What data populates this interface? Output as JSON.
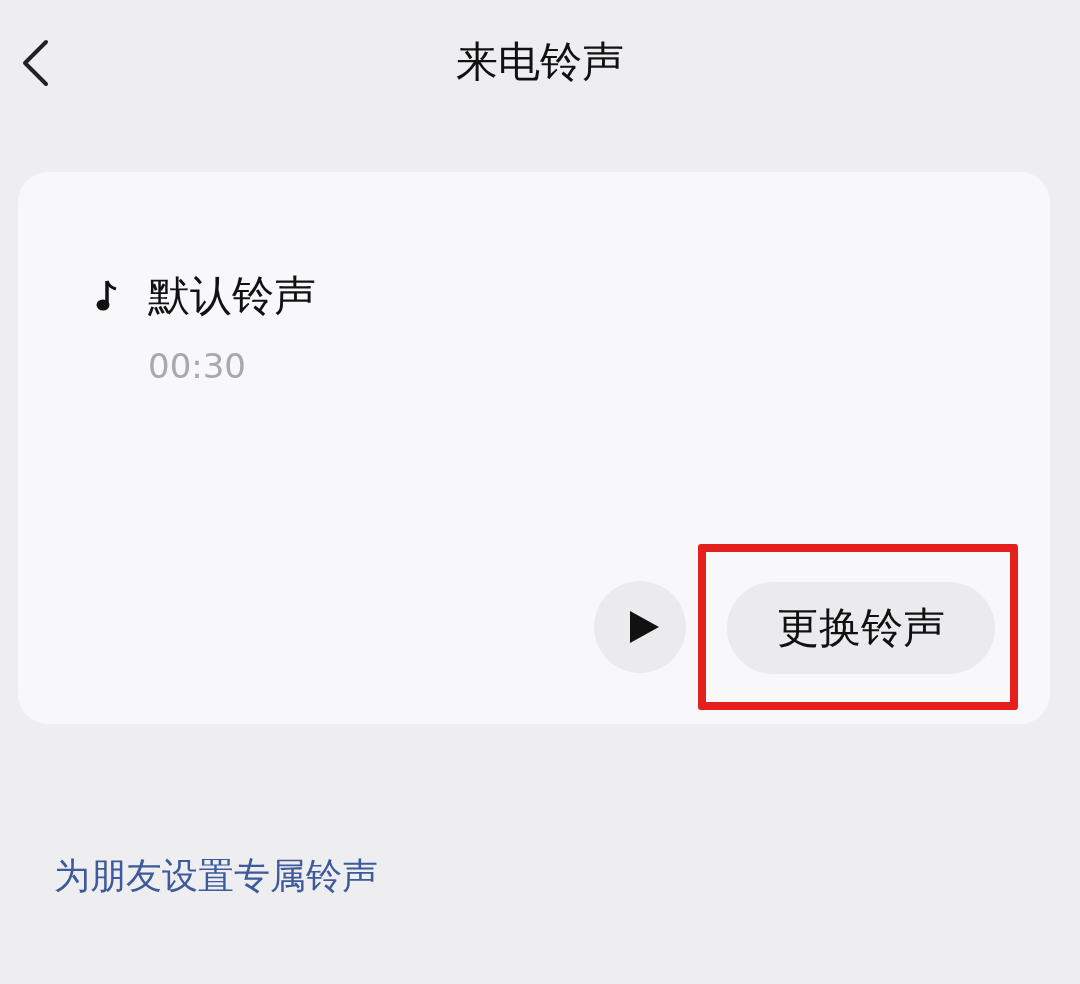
{
  "header": {
    "title": "来电铃声"
  },
  "ringtone": {
    "name": "默认铃声",
    "duration": "00:30"
  },
  "change_button": {
    "label": "更换铃声",
    "highlighted": true
  },
  "friend_link": "为朋友设置专属铃声"
}
